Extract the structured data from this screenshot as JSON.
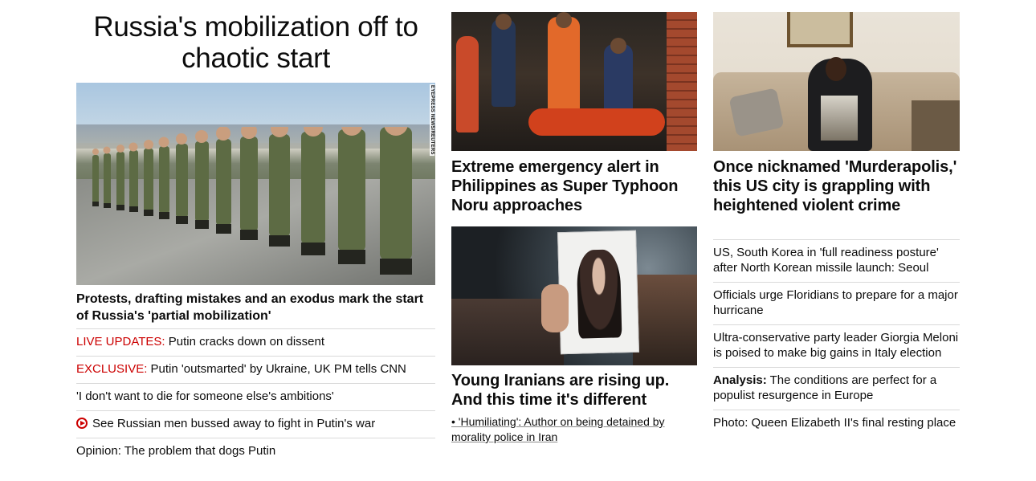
{
  "lead": {
    "headline": "Russia's mobilization off to chaotic start",
    "image_credit": "EYEPRESS NEWS/REUTERS",
    "caption": "Protests, drafting mistakes and an exodus mark the start of Russia's 'partial mobilization'",
    "links": [
      {
        "kicker": "LIVE UPDATES:",
        "text": " Putin cracks down on dissent"
      },
      {
        "kicker": "EXCLUSIVE:",
        "text": " Putin 'outsmarted' by Ukraine, UK PM tells CNN"
      },
      {
        "text": "'I don't want to die for someone else's ambitions'"
      },
      {
        "icon": "play-icon",
        "text": "See Russian men bussed away to fight in Putin's war"
      },
      {
        "text": "Opinion: The problem that dogs Putin"
      }
    ]
  },
  "column2": {
    "story1": {
      "title": "Extreme emergency alert in Philippines as Super Typhoon Noru approaches"
    },
    "story2": {
      "title": "Young Iranians are rising up. And this time it's different",
      "sub_link": "• 'Humiliating': Author on being detained by morality police in Iran"
    }
  },
  "column3": {
    "story": {
      "title": "Once nicknamed 'Murderapolis,' this US city is grappling with heightened violent crime"
    },
    "links": [
      {
        "text": "US, South Korea in 'full readiness posture' after North Korean missile launch: Seoul"
      },
      {
        "text": "Officials urge Floridians to prepare for a major hurricane"
      },
      {
        "text": "Ultra-conservative party leader Giorgia Meloni is poised to make big gains in Italy election"
      },
      {
        "bold": "Analysis:",
        "text": " The conditions are perfect for a populist resurgence in Europe"
      },
      {
        "text": "Photo: Queen Elizabeth II's final resting place"
      }
    ]
  },
  "colors": {
    "kicker": "#cc0000",
    "divider": "#d9d9d9",
    "text": "#0c0c0c"
  }
}
